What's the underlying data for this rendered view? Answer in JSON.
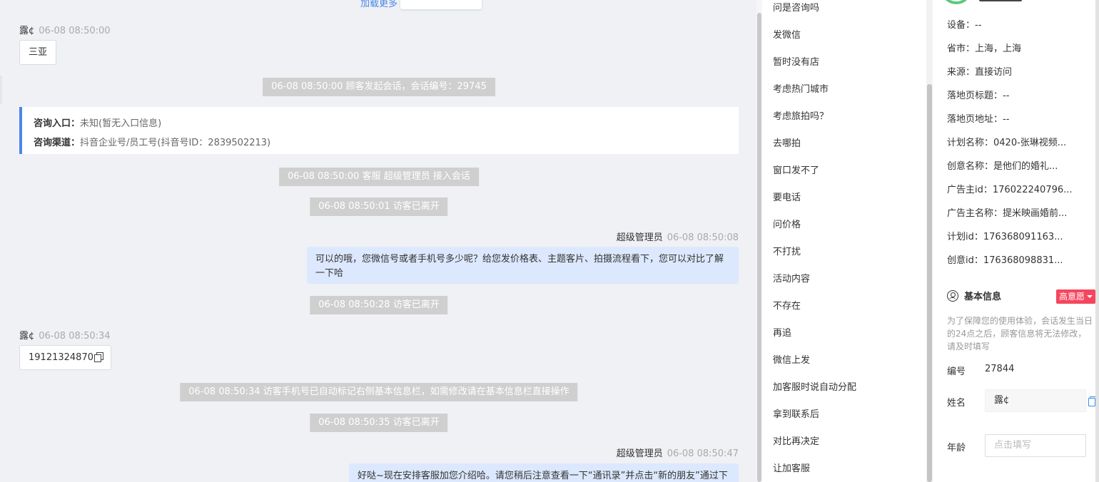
{
  "chat": {
    "load_more": "加载更多",
    "messages": [
      {
        "who": "露¢",
        "time": "06-08 08:50:00",
        "text": "三亚"
      },
      {
        "system": "06-08 08:50:00 顾客发起会话，会话编号：29745"
      },
      {
        "system": "06-08 08:50:00 客服 超级管理员 接入会话"
      },
      {
        "system": "06-08 08:50:01 访客已离开"
      },
      {
        "who": "超级管理员",
        "time": "06-08 08:50:08",
        "text": "可以的哦，您微信号或者手机号多少呢？给您发价格表、主题客片、拍摄流程看下，您可以对比了解一下哈"
      },
      {
        "system": "06-08 08:50:28 访客已离开"
      },
      {
        "who": "露¢",
        "time": "06-08 08:50:34",
        "text": "19121324870"
      },
      {
        "system": "06-08 08:50:34 访客手机号已自动标记右侧基本信息栏，如需修改请在基本信息栏直接操作"
      },
      {
        "system": "06-08 08:50:35 访客已离开"
      },
      {
        "who": "超级管理员",
        "time": "06-08 08:50:47",
        "text": "好哒~现在安排客服加您介绍哈。请您稍后注意查看一下“通讯录”并点击“新的朋友”通过下哦"
      }
    ],
    "info_card": {
      "entry_label": "咨询入口：",
      "entry_value": "未知(暂无入口信息)",
      "channel_label": "咨询渠道：",
      "channel_value": "抖音企业号/员工号(抖音号ID：2839502213)"
    }
  },
  "quick_replies": [
    "问是咨询吗",
    "发微信",
    "暂时没有店",
    "考虑热门城市",
    "考虑旅拍吗？",
    "去哪拍",
    "窗口发不了",
    "要电话",
    "问价格",
    "不打扰",
    "活动内容",
    "不存在",
    "再追",
    "微信上发",
    "加客服时说自动分配",
    "拿到联系后",
    "对比再决定",
    "让加客服"
  ],
  "visitor": {
    "fields": [
      {
        "label": "设备：",
        "value": "--"
      },
      {
        "label": "省市：",
        "value": "上海，上海"
      },
      {
        "label": "来源：",
        "value": "直接访问"
      },
      {
        "label": "落地页标题：",
        "value": "--"
      },
      {
        "label": "落地页地址：",
        "value": "--"
      },
      {
        "label": "计划名称：",
        "value": "0420-张琳视频..."
      },
      {
        "label": "创意名称：",
        "value": "是他们的婚礼..."
      },
      {
        "label": "广告主id：",
        "value": "176022240796..."
      },
      {
        "label": "广告主名称：",
        "value": "提米映画婚前..."
      },
      {
        "label": "计划id：",
        "value": "176368091163..."
      },
      {
        "label": "创意id：",
        "value": "176368098831..."
      }
    ],
    "basic": {
      "title": "基本信息",
      "intent_badge": "高意愿",
      "notice": "为了保障您的使用体验，会话发生当日的24点之后，顾客信息将无法修改，请及时填写",
      "id_label": "编号",
      "id_value": "27844",
      "name_label": "姓名",
      "name_value": "露¢",
      "age_label": "年龄",
      "age_placeholder": "点击填写"
    }
  },
  "colors": {
    "accent": "#4a86e8",
    "bubble_self": "#dce8fd",
    "badge": "#f5465e",
    "system_chip": "#cfcfcf"
  }
}
